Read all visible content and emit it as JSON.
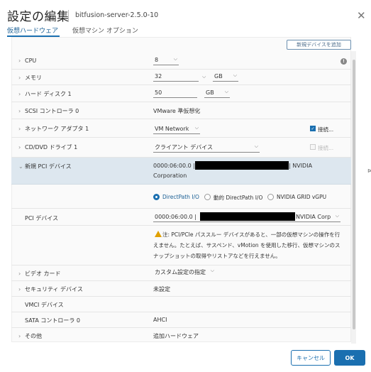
{
  "dialog": {
    "title": "設定の編集",
    "vm_name": "bitfusion-server-2.5.0-10",
    "tabs": [
      {
        "label": "仮想ハードウェア"
      },
      {
        "label": "仮想マシン オプション"
      }
    ],
    "add_device_label": "新規デバイスを追加"
  },
  "rows": {
    "cpu": {
      "label": "CPU",
      "value": "8"
    },
    "memory": {
      "label": "メモリ",
      "value": "32",
      "unit": "GB"
    },
    "disk": {
      "label": "ハード ディスク 1",
      "value": "50",
      "unit": "GB"
    },
    "scsi": {
      "label": "SCSI コントローラ 0",
      "value": "VMware 準仮想化"
    },
    "network": {
      "label": "ネットワーク アダプタ 1",
      "value": "VM Network",
      "connect_label": "接続..."
    },
    "cddvd": {
      "label": "CD/DVD ドライブ 1",
      "value": "クライアント デバイス",
      "connect_label": "接続..."
    },
    "pci_new": {
      "label": "新規 PCI デバイス",
      "addr_prefix": "0000:06:00.0 |",
      "vendor_suffix": "| NVIDIA",
      "vendor_line2": "Corporation",
      "options": [
        {
          "label": "DirectPath I/O"
        },
        {
          "label": "動的 DirectPath I/O"
        },
        {
          "label": "NVIDIA GRID vGPU"
        }
      ]
    },
    "pci_device": {
      "label": "PCI デバイス",
      "addr_prefix": "0000:06:00.0 |",
      "vendor_suffix": "NVIDIA Corp"
    },
    "warning": "注: PCI/PCIe パススルー デバイスがあると、一部の仮想マシンの操作を行えません。たとえば、サスペンド、vMotion を使用した移行、仮想マシンのスナップショットの取得やリストアなどを行えません。",
    "video": {
      "label": "ビデオ カード",
      "value": "カスタム設定の指定"
    },
    "security": {
      "label": "セキュリティ デバイス",
      "value": "未設定"
    },
    "vmci": {
      "label": "VMCI デバイス"
    },
    "sata": {
      "label": "SATA コントローラ 0",
      "value": "AHCI"
    },
    "other": {
      "label": "その他",
      "value": "追加ハードウェア"
    }
  },
  "footer": {
    "cancel_label": "キャンセル",
    "ok_label": "OK"
  }
}
